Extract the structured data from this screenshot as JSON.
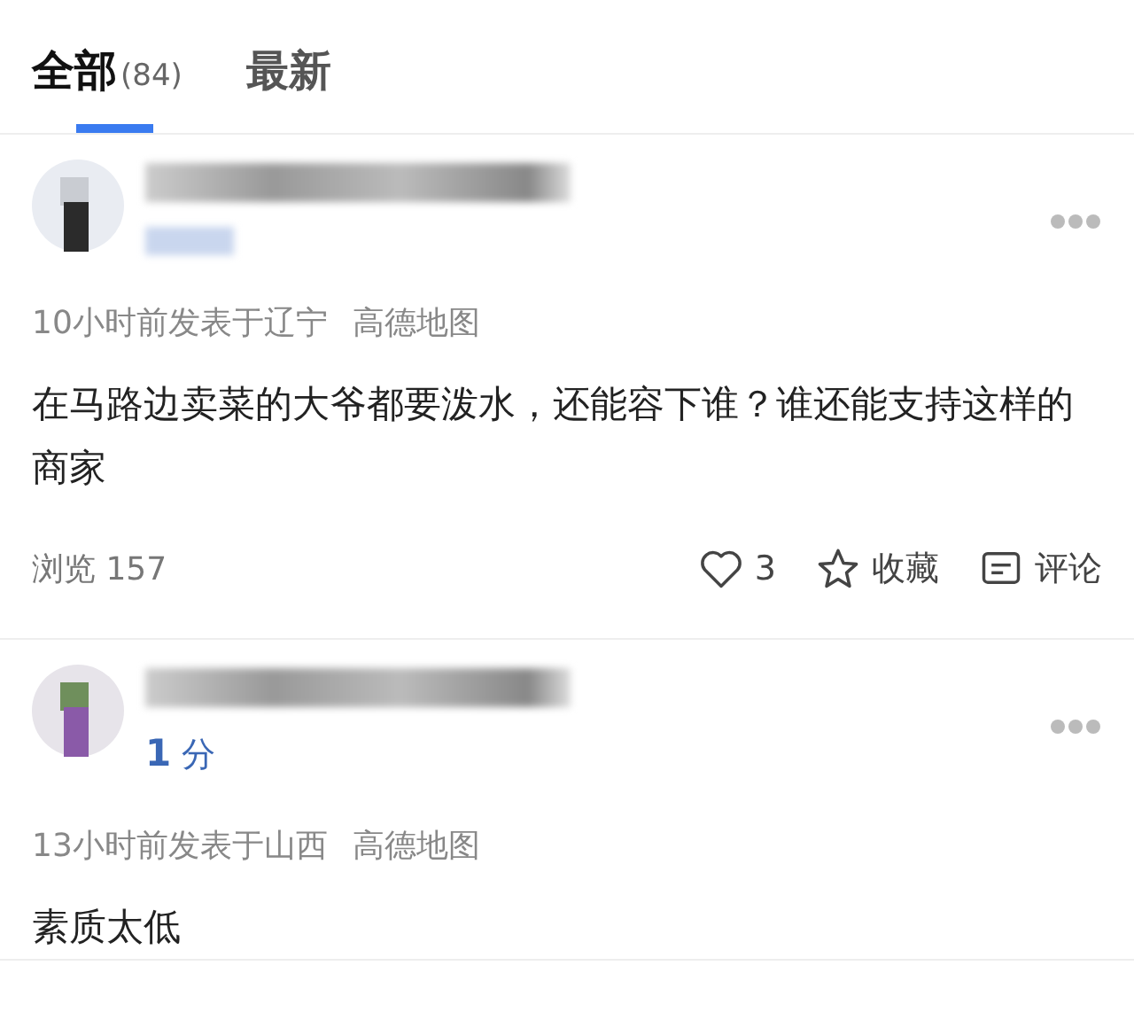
{
  "tabs": [
    {
      "label": "全部",
      "count": "(84)",
      "selected": true
    },
    {
      "label": "最新",
      "selected": false
    }
  ],
  "comments": [
    {
      "meta": "10小时前发表于辽宁",
      "source": "高德地图",
      "text": "在马路边卖菜的大爷都要泼水，还能容下谁？谁还能支持这样的商家",
      "views": "浏览 157",
      "likes": "3",
      "favorite": "收藏",
      "reply": "评论"
    },
    {
      "score": "1",
      "score_unit": "分",
      "meta": "13小时前发表于山西",
      "source": "高德地图",
      "text": "素质太低"
    }
  ]
}
